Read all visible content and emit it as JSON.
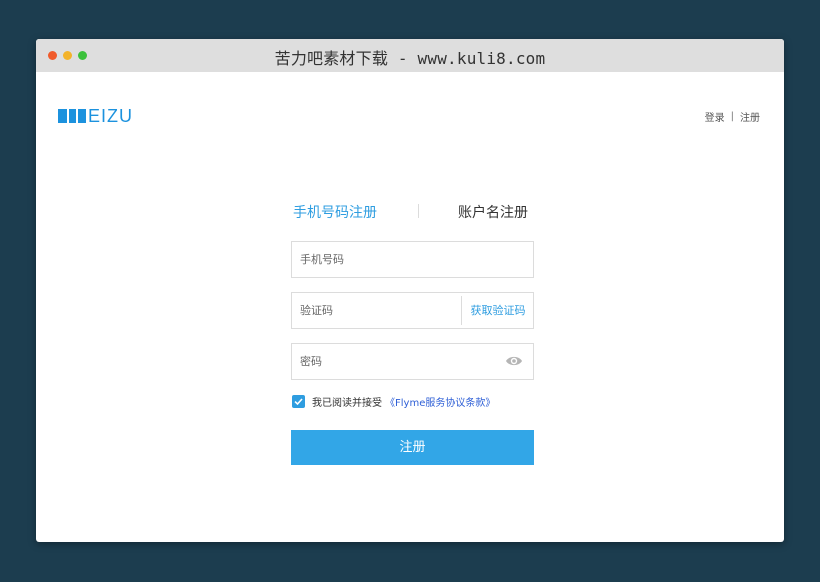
{
  "browser": {
    "title": "苦力吧素材下载 - www.kuli8.com"
  },
  "header": {
    "logo_text": "EIZU",
    "login_link": "登录",
    "separator": "|",
    "register_link": "注册"
  },
  "tabs": [
    {
      "label": "手机号码注册",
      "active": true
    },
    {
      "label": "账户名注册",
      "active": false
    }
  ],
  "form": {
    "phone_placeholder": "手机号码",
    "code_placeholder": "验证码",
    "get_code_label": "获取验证码",
    "password_placeholder": "密码",
    "agree_text": "我已阅读并接受",
    "agree_link": "《Flyme服务协议条款》",
    "agree_checked": true,
    "submit_label": "注册"
  },
  "colors": {
    "background": "#1c3d4f",
    "accent": "#32a6e7",
    "logo": "#1c92de"
  },
  "icons": [
    "eye-icon",
    "check-icon"
  ]
}
